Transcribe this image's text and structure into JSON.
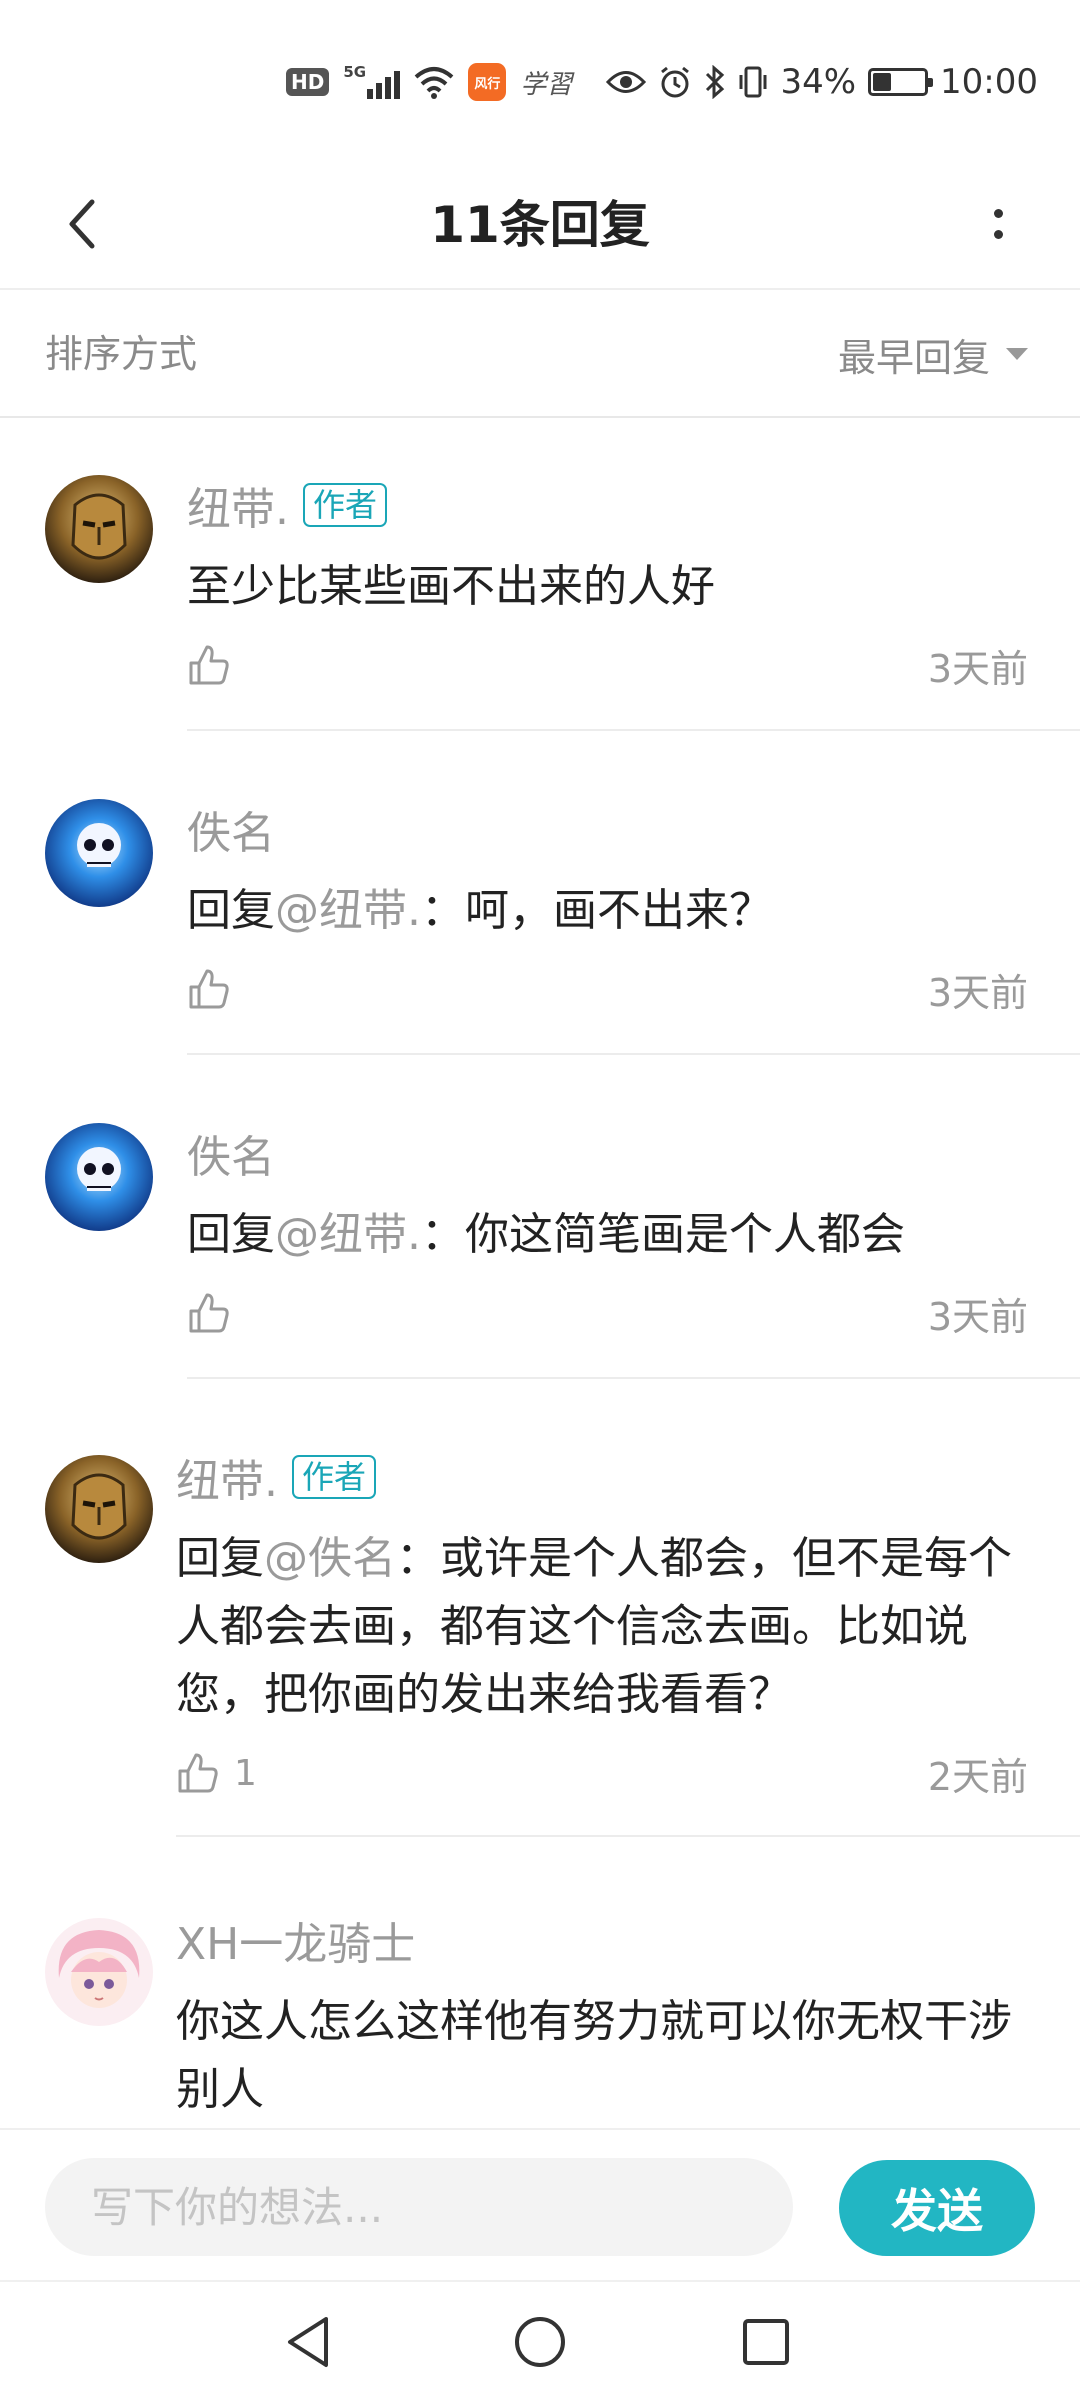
{
  "status_bar": {
    "hd": "HD",
    "network": "5G",
    "app1": "风行",
    "app2": "学習",
    "battery_percent": "34%",
    "battery_level": 0.34,
    "time": "10:00"
  },
  "header": {
    "title": "11条回复"
  },
  "sort": {
    "label": "排序方式",
    "value": "最早回复"
  },
  "comments": [
    {
      "author": "纽带.",
      "badge": "作者",
      "mention": "",
      "text": "至少比某些画不出来的人好",
      "likes": "",
      "time": "3天前",
      "avatar": "golden-mask-avatar"
    },
    {
      "author": "佚名",
      "badge": "",
      "prefix": "回复",
      "mention": "@纽带.",
      "text": "：呵，画不出来？",
      "likes": "",
      "time": "3天前",
      "avatar": "blue-skull-avatar"
    },
    {
      "author": "佚名",
      "badge": "",
      "prefix": "回复",
      "mention": "@纽带.",
      "text": "：你这简笔画是个人都会",
      "likes": "",
      "time": "3天前",
      "avatar": "blue-skull-avatar"
    },
    {
      "author": "纽带.",
      "badge": "作者",
      "prefix": "回复",
      "mention": "@佚名",
      "text": "：或许是个人都会，但不是每个人都会去画，都有这个信念去画。比如说您，把你画的发出来给我看看？",
      "likes": "1",
      "time": "2天前",
      "avatar": "golden-mask-avatar"
    },
    {
      "author": "XH一龙骑士",
      "badge": "",
      "mention": "",
      "text": "你这人怎么这样他有努力就可以你无权干涉别人",
      "likes": "",
      "time": "",
      "avatar": "pink-hair-avatar"
    }
  ],
  "composer": {
    "placeholder": "写下你的想法...",
    "send_label": "发送"
  },
  "colors": {
    "accent": "#22b6c3",
    "badge": "#1aa6b7",
    "muted_text": "#9a9a9a"
  }
}
